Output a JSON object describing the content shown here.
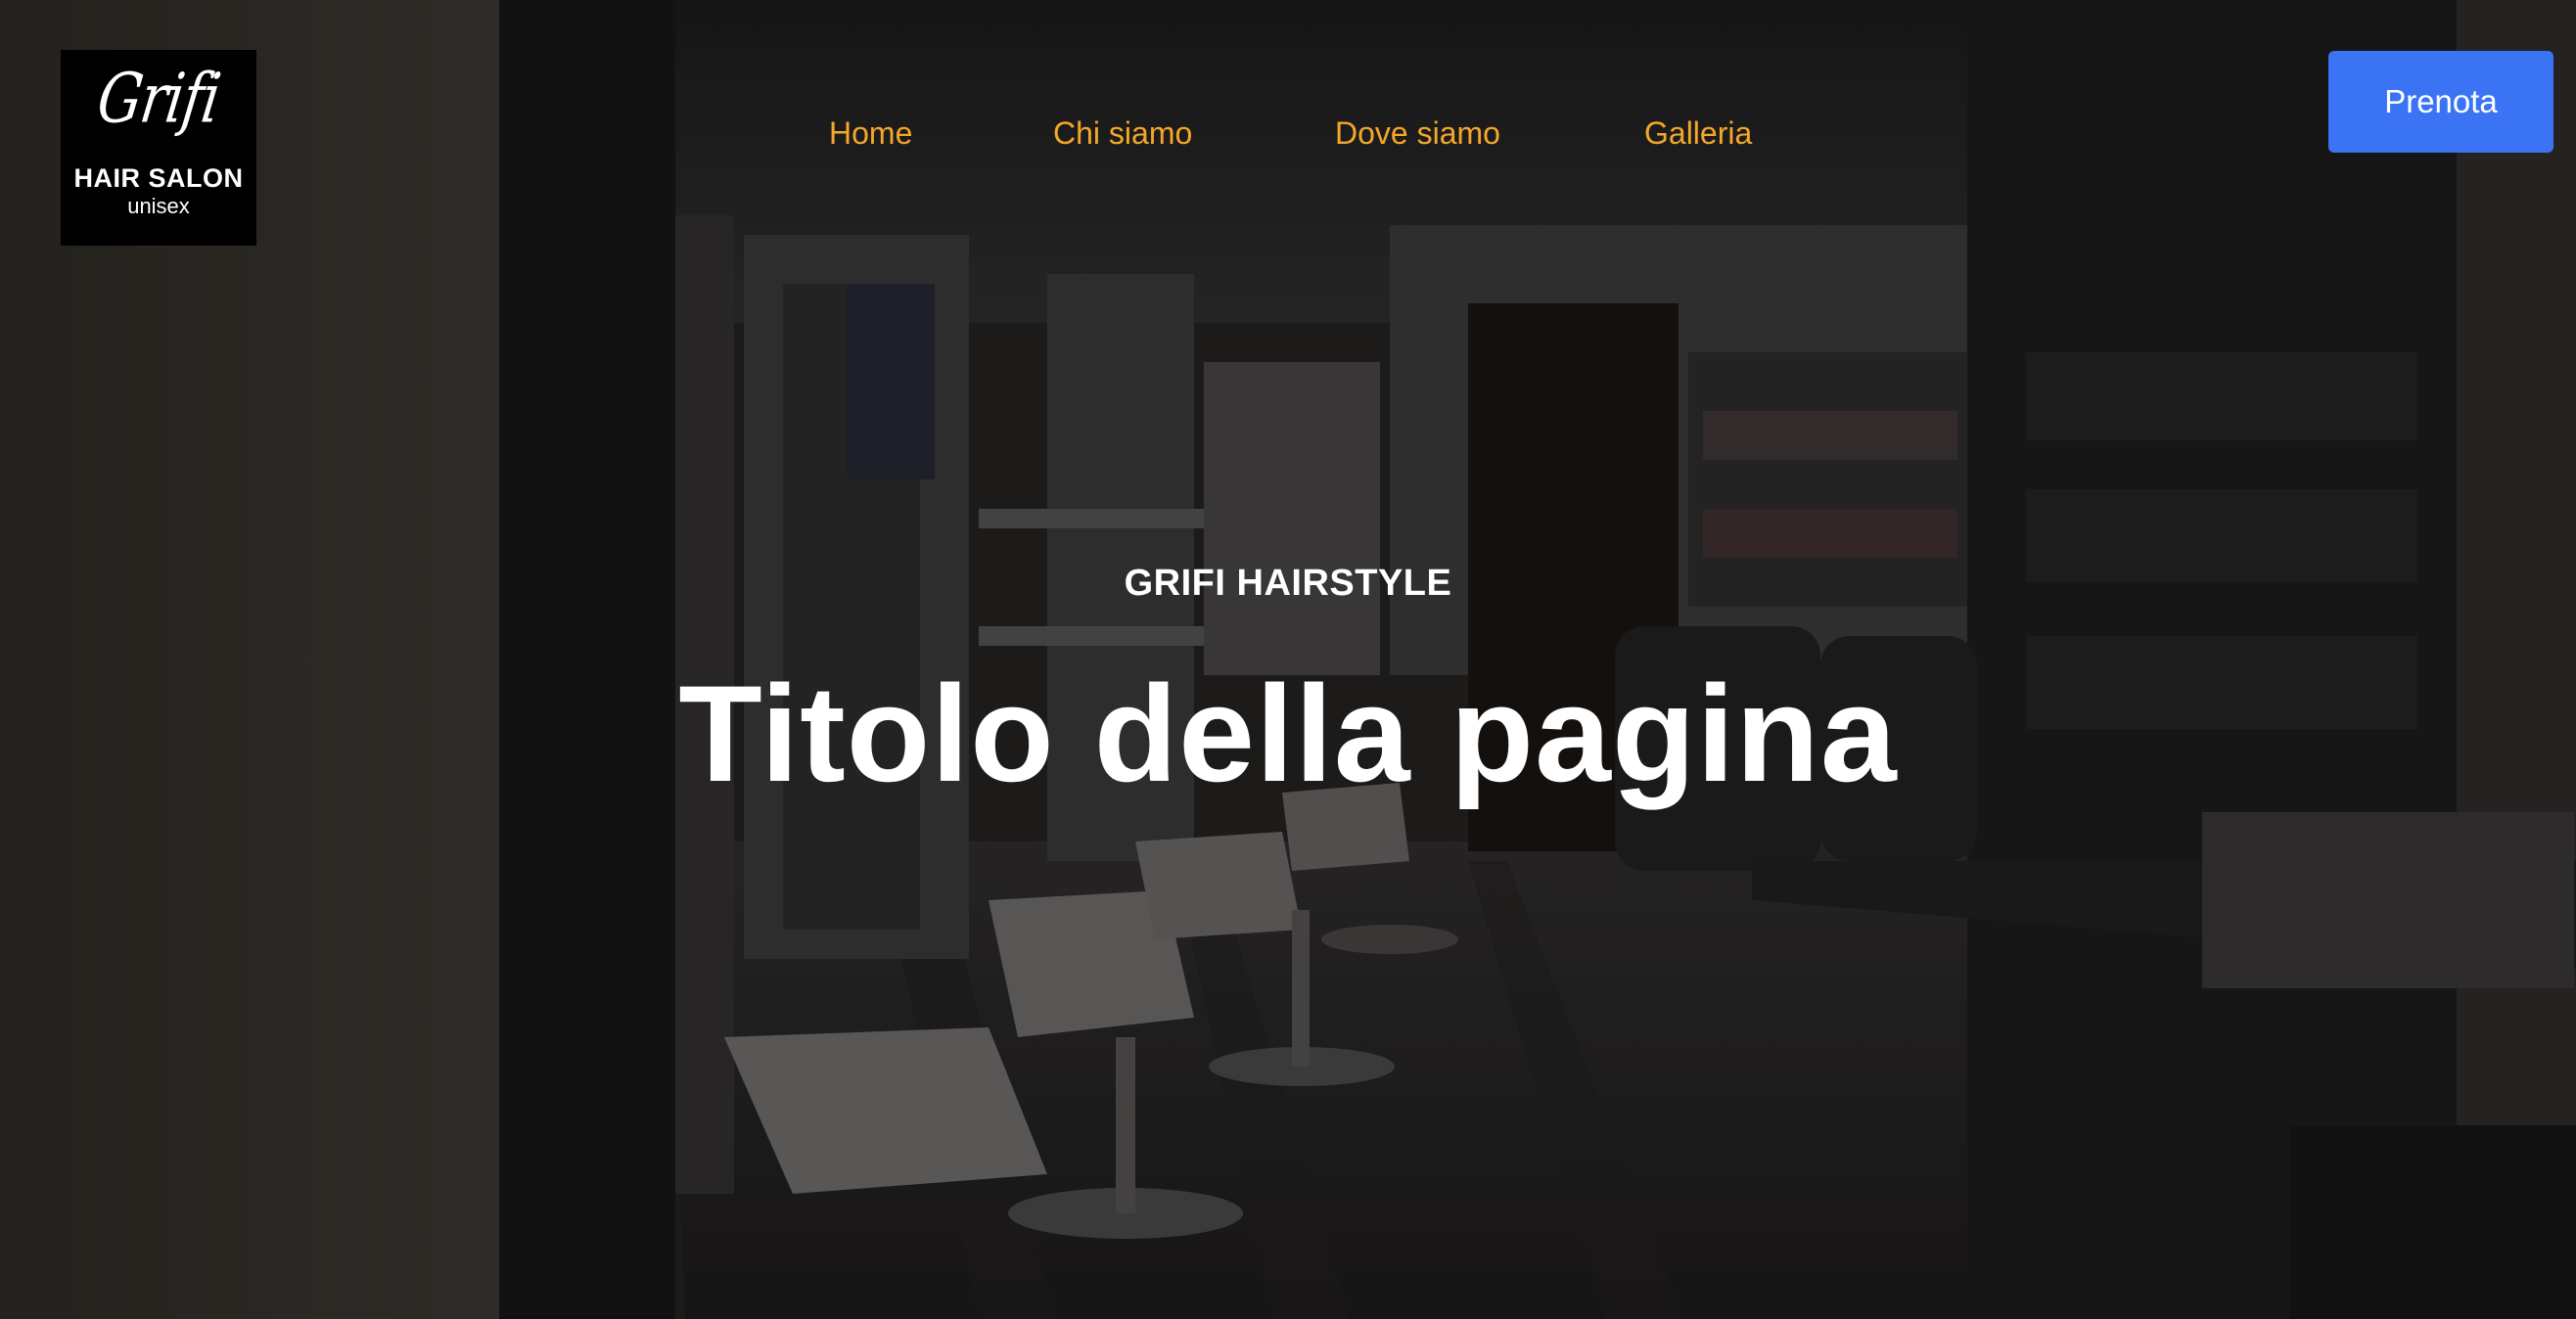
{
  "logo": {
    "script_text": "Grifi",
    "brand_text": "HAIR SALON",
    "sub_text": "unisex"
  },
  "nav": {
    "items": [
      {
        "label": "Home"
      },
      {
        "label": "Chi siamo"
      },
      {
        "label": "Dove siamo"
      },
      {
        "label": "Galleria"
      }
    ]
  },
  "cta": {
    "label": "Prenota"
  },
  "hero": {
    "eyebrow": "GRIFI HAIRSTYLE",
    "title": "Titolo della pagina",
    "background": "salon-interior-photo"
  },
  "colors": {
    "nav_link": "#f4a72a",
    "cta_bg": "#3a74f5",
    "text": "#ffffff"
  }
}
